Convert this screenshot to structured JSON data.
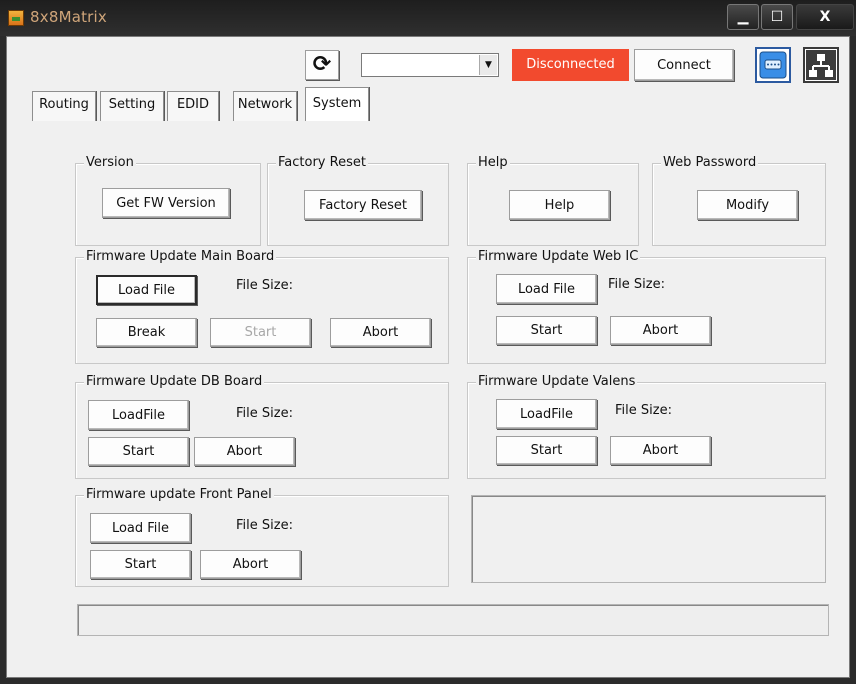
{
  "window": {
    "title": "8x8Matrix",
    "minimize": "▁",
    "maximize": "☐",
    "close": "X"
  },
  "toolbar": {
    "refresh_glyph": "⟳",
    "port_select": {
      "value": "",
      "arrow": "▼"
    },
    "status": "Disconnected",
    "status_color": "#f24a2e",
    "connect": "Connect",
    "icons": [
      "serial-port-icon",
      "network-icon"
    ]
  },
  "tabs": [
    {
      "label": "Routing"
    },
    {
      "label": "Setting"
    },
    {
      "label": "EDID"
    },
    {
      "label": "Network"
    },
    {
      "label": "System",
      "active": true
    }
  ],
  "groups": {
    "version": {
      "title": "Version",
      "button": "Get FW Version"
    },
    "factory_reset": {
      "title": "Factory Reset",
      "button": "Factory Reset"
    },
    "help": {
      "title": "Help",
      "button": "Help"
    },
    "web_password": {
      "title": "Web Password",
      "button": "Modify"
    },
    "fw_main": {
      "title": "Firmware Update Main Board",
      "load": "Load File",
      "file_size": "File Size:",
      "break": "Break",
      "start": "Start",
      "abort": "Abort"
    },
    "fw_web_ic": {
      "title": "Firmware Update Web IC",
      "load": "Load File",
      "file_size": "File Size:",
      "start": "Start",
      "abort": "Abort"
    },
    "fw_db": {
      "title": "Firmware Update DB Board",
      "load": "LoadFile",
      "file_size": "File Size:",
      "start": "Start",
      "abort": "Abort"
    },
    "fw_valens": {
      "title": "Firmware Update Valens",
      "load": "LoadFile",
      "file_size": "File Size:",
      "start": "Start",
      "abort": "Abort"
    },
    "fw_front": {
      "title": "Firmware update Front Panel",
      "load": "Load File",
      "file_size": "File Size:",
      "start": "Start",
      "abort": "Abort"
    }
  },
  "info_box": "",
  "progress_bar": {
    "value": 0
  }
}
